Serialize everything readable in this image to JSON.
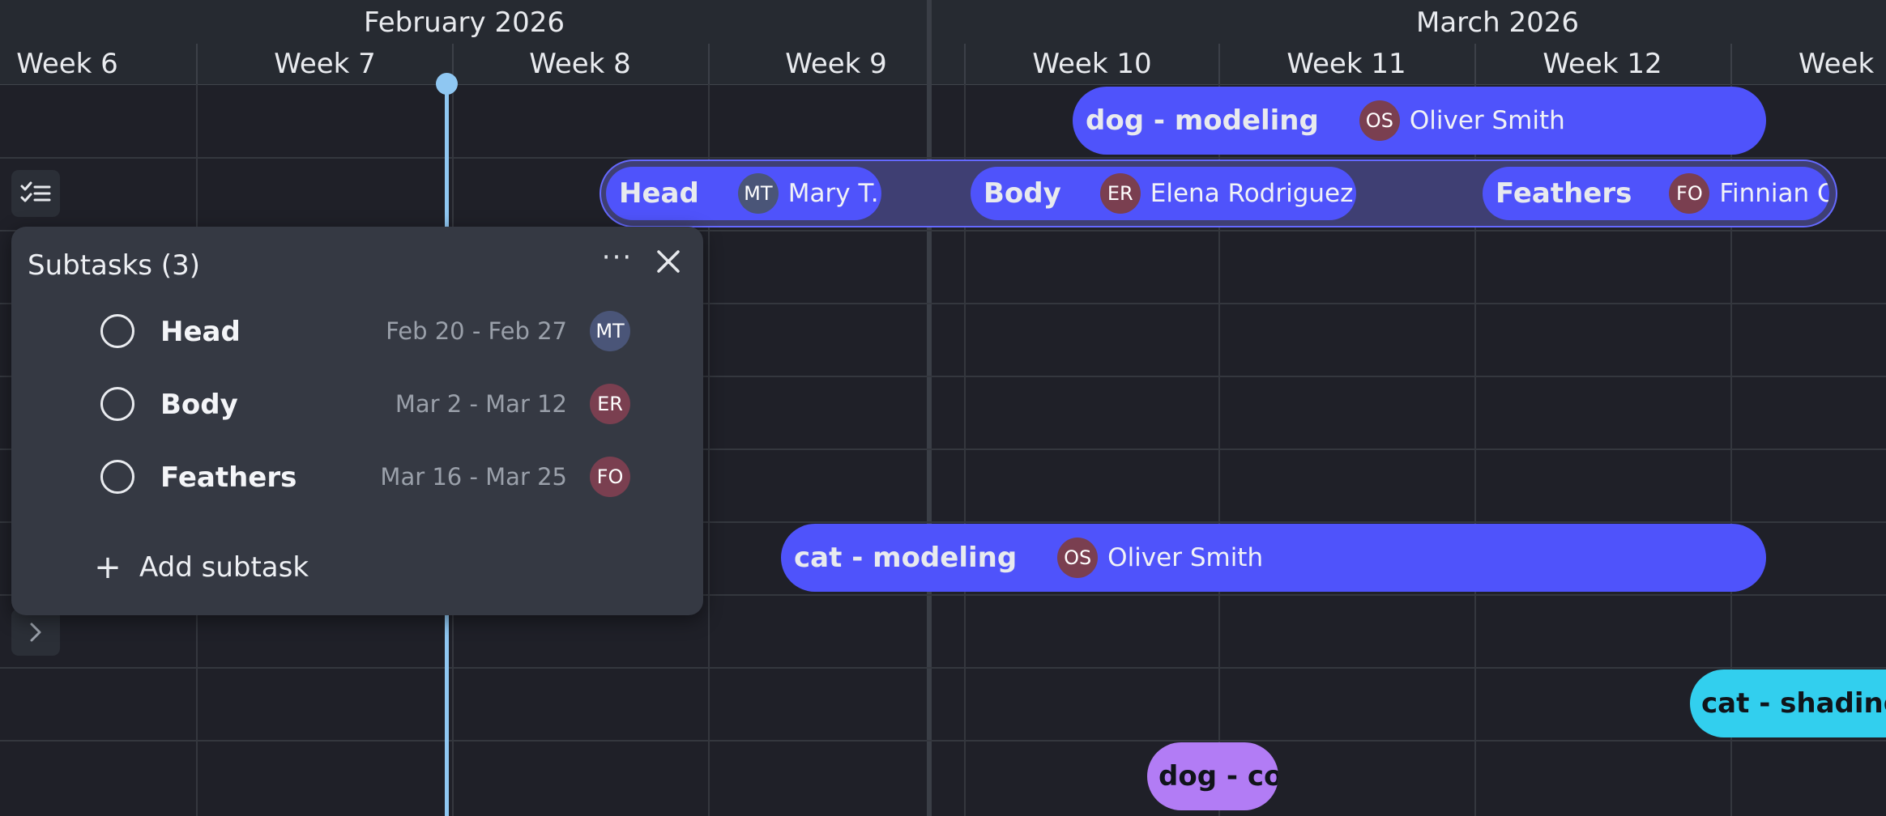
{
  "timeline": {
    "months": [
      "February 2026",
      "March 2026"
    ],
    "weeks": [
      "Week 6",
      "Week 7",
      "Week 8",
      "Week 9",
      "Week 10",
      "Week 11",
      "Week 12",
      "Week"
    ]
  },
  "tasks": {
    "dog_modeling": {
      "title": "dog - modeling",
      "avatar": "OS",
      "assignee": "Oliver Smith"
    },
    "cat_modeling": {
      "title": "cat - modeling",
      "avatar": "OS",
      "assignee": "Oliver Smith"
    },
    "cat_shading": {
      "title": "cat - shading"
    },
    "dog_cor": {
      "title": "dog - cor"
    }
  },
  "subtask_bars": [
    {
      "title": "Head",
      "avatar": "MT",
      "assignee": "Mary T..."
    },
    {
      "title": "Body",
      "avatar": "ER",
      "assignee": "Elena Rodriguez"
    },
    {
      "title": "Feathers",
      "avatar": "FO",
      "assignee": "Finnian O..."
    }
  ],
  "panel": {
    "title": "Subtasks (3)",
    "more": "···",
    "items": [
      {
        "name": "Head",
        "dates": "Feb 20 - Feb 27",
        "avatar": "MT"
      },
      {
        "name": "Body",
        "dates": "Mar 2 - Mar 12",
        "avatar": "ER"
      },
      {
        "name": "Feathers",
        "dates": "Mar 16 - Mar 25",
        "avatar": "FO"
      }
    ],
    "add_label": "Add subtask"
  },
  "colors": {
    "bar_blue": "#4f53fb",
    "bar_cyan": "#32cfee",
    "bar_purple": "#b27cf5",
    "today_line": "#8fc7f2",
    "background": "#1f2028"
  },
  "icons": [
    "checklist-icon",
    "chevron-right-icon",
    "more-icon",
    "close-icon",
    "plus-icon"
  ]
}
